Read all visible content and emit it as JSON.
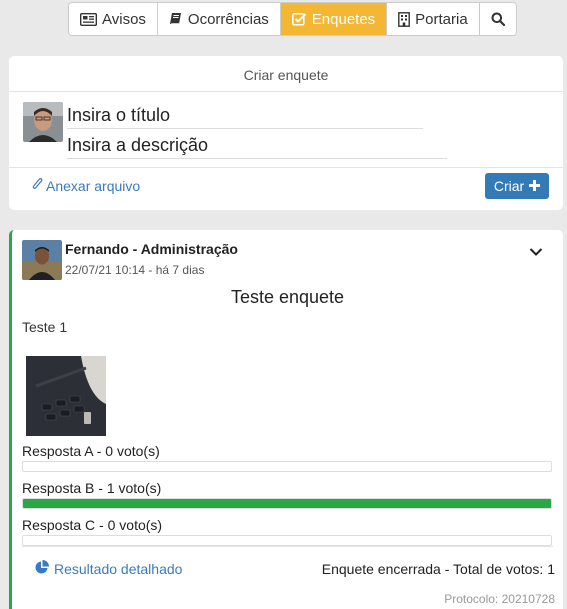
{
  "nav": {
    "items": [
      {
        "label": "Avisos",
        "icon": "newspaper-icon"
      },
      {
        "label": "Ocorrências",
        "icon": "book-icon"
      },
      {
        "label": "Enquetes",
        "icon": "check-square-icon"
      },
      {
        "label": "Portaria",
        "icon": "building-icon"
      }
    ],
    "active": "Enquetes",
    "active_color": "#f4b733"
  },
  "create": {
    "header": "Criar enquete",
    "title_placeholder": "Insira o título",
    "description_placeholder": "Insira a descrição",
    "attach_label": "Anexar arquivo",
    "submit_label": "Criar"
  },
  "post": {
    "author": "Fernando - Administração",
    "date": "22/07/21 10:14 - há 7 dias",
    "title": "Teste enquete",
    "description": "Teste 1",
    "options": [
      {
        "name": "Resposta A",
        "votes_text": "0 voto(s)",
        "share": 0
      },
      {
        "name": "Resposta B",
        "votes_text": "1 voto(s)",
        "share": 1
      },
      {
        "name": "Resposta C",
        "votes_text": "0 voto(s)",
        "share": 0
      }
    ],
    "result_link": "Resultado detalhado",
    "status_label": "Enquete encerrada",
    "total_label": "Total de votos: 1",
    "protocol": "Protocolo: 20210728",
    "accent_color": "#2ea44f",
    "bar_color": "#28a745"
  },
  "colors": {
    "link": "#3a7bbf",
    "primary_button": "#337ab7",
    "background": "#e9e9e9"
  }
}
